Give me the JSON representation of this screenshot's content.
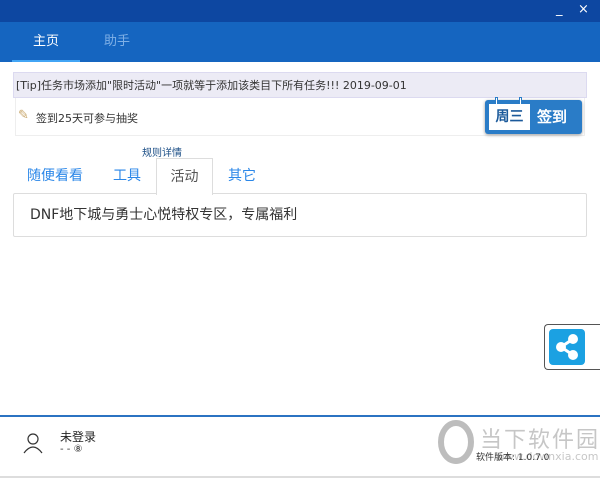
{
  "window": {
    "minimize": "_",
    "close": "×"
  },
  "nav": {
    "tabs": [
      {
        "label": "主页"
      },
      {
        "label": "助手"
      }
    ]
  },
  "tip": "[Tip]任务市场添加\"限时活动\"一项就等于添加该类目下所有任务!!!  2019-09-01",
  "sign": {
    "text": "签到25天可参与抽奖",
    "day": "周三",
    "button": "签到",
    "rules": "规则详情"
  },
  "subtabs": [
    {
      "label": "随便看看"
    },
    {
      "label": "工具"
    },
    {
      "label": "活动"
    },
    {
      "label": "其它"
    }
  ],
  "activity": {
    "item": "DNF地下城与勇士心悦特权专区，专属福利"
  },
  "footer": {
    "user": "未登录",
    "status": "- - ⑧",
    "version": "软件版本: 1.0.7.0"
  },
  "watermark": {
    "name": "当下软件园",
    "url": "www.downxia.com"
  },
  "colors": {
    "title": "#0d47a1",
    "nav": "#1565c0",
    "share": "#1ba1e2",
    "tab": "#2b87e8"
  }
}
